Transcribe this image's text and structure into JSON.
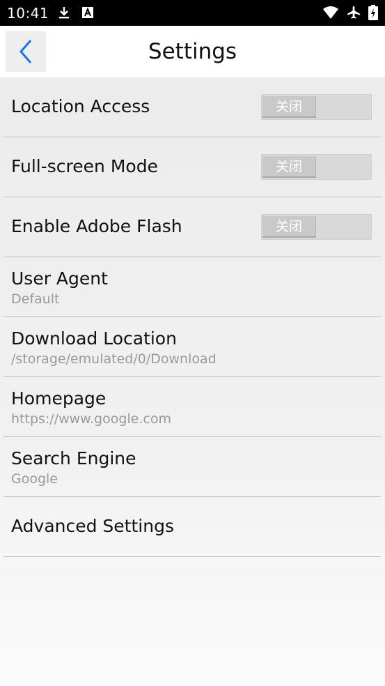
{
  "status_bar": {
    "time": "10:41",
    "icons_left": [
      "download-icon",
      "font-a-icon"
    ],
    "icons_right": [
      "wifi-icon",
      "airplane-icon",
      "battery-icon"
    ]
  },
  "header": {
    "back_icon": "chevron-left-icon",
    "title": "Settings"
  },
  "settings": {
    "location_access": {
      "label": "Location Access",
      "toggle_text": "关闭",
      "enabled": false
    },
    "full_screen": {
      "label": "Full-screen Mode",
      "toggle_text": "关闭",
      "enabled": false
    },
    "adobe_flash": {
      "label": "Enable Adobe Flash",
      "toggle_text": "关闭",
      "enabled": false
    },
    "user_agent": {
      "label": "User Agent",
      "value": "Default"
    },
    "download_location": {
      "label": "Download Location",
      "value": "/storage/emulated/0/Download"
    },
    "homepage": {
      "label": "Homepage",
      "value": "https://www.google.com"
    },
    "search_engine": {
      "label": "Search Engine",
      "value": "Google"
    },
    "advanced": {
      "label": "Advanced Settings"
    }
  },
  "colors": {
    "accent": "#1a73e8",
    "status_bar_bg": "#000000",
    "secondary_text": "#9a9a9a"
  }
}
